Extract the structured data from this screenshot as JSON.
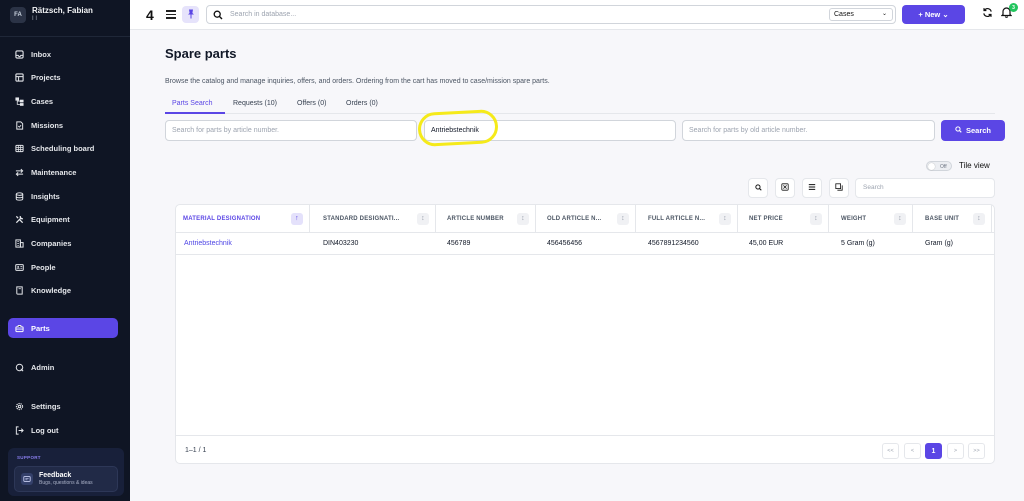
{
  "user": {
    "initials": "FA",
    "name": "Rätzsch, Fabian",
    "subtitle": "I I"
  },
  "sidebar": {
    "items": [
      {
        "label": "Inbox",
        "icon": "inbox-icon"
      },
      {
        "label": "Projects",
        "icon": "projects-icon"
      },
      {
        "label": "Cases",
        "icon": "cases-icon"
      },
      {
        "label": "Missions",
        "icon": "missions-icon"
      },
      {
        "label": "Scheduling board",
        "icon": "calendar-grid-icon"
      },
      {
        "label": "Maintenance",
        "icon": "arrows-swap-icon"
      },
      {
        "label": "Insights",
        "icon": "database-icon"
      },
      {
        "label": "Equipment",
        "icon": "tools-icon"
      },
      {
        "label": "Companies",
        "icon": "building-icon"
      },
      {
        "label": "People",
        "icon": "id-card-icon"
      },
      {
        "label": "Knowledge",
        "icon": "book-icon"
      },
      {
        "label": "Parts",
        "icon": "toolbox-icon",
        "active": true
      },
      {
        "label": "Admin",
        "icon": "admin-icon"
      },
      {
        "label": "Settings",
        "icon": "gear-icon"
      },
      {
        "label": "Log out",
        "icon": "logout-icon"
      }
    ],
    "support_label": "SUPPORT",
    "feedback_title": "Feedback",
    "feedback_sub": "Bugs, questions & ideas"
  },
  "topbar": {
    "logo": "4",
    "search_placeholder": "Search in database...",
    "scope": "Cases",
    "new_label": "+  New  ⌄",
    "notifications": "3"
  },
  "page": {
    "title": "Spare parts",
    "description": "Browse the catalog and manage inquiries, offers, and orders. Ordering from the cart has moved to case/mission spare parts.",
    "tabs": [
      "Parts Search",
      "Requests (10)",
      "Offers (0)",
      "Orders (0)"
    ],
    "active_tab": 0
  },
  "search": {
    "article_placeholder": "Search for parts by article number.",
    "designation_value": "Antriebstechnik",
    "old_article_placeholder": "Search for parts by old article number.",
    "button": "Search"
  },
  "view": {
    "toggle_state": "Off",
    "tile_label": "Tile view",
    "table_search_placeholder": "Search"
  },
  "table": {
    "columns": [
      "MATERIAL DESIGNATION",
      "STANDARD DESIGNATI...",
      "ARTICLE NUMBER",
      "OLD ARTICLE N...",
      "FULL ARTICLE N...",
      "NET PRICE",
      "WEIGHT",
      "BASE UNIT"
    ],
    "rows": [
      [
        "Antriebstechnik",
        "DIN403230",
        "456789",
        "456456456",
        "4567891234560",
        "45,00 EUR",
        "5 Gram (g)",
        "Gram (g)"
      ]
    ],
    "range": "1–1 / 1",
    "pagination": [
      "<<",
      "<",
      "1",
      ">",
      ">>"
    ],
    "current_page": "1"
  },
  "colors": {
    "accent": "#5b46e5",
    "sidebar_bg": "#0f1524",
    "highlight": "#f5ea1a"
  }
}
